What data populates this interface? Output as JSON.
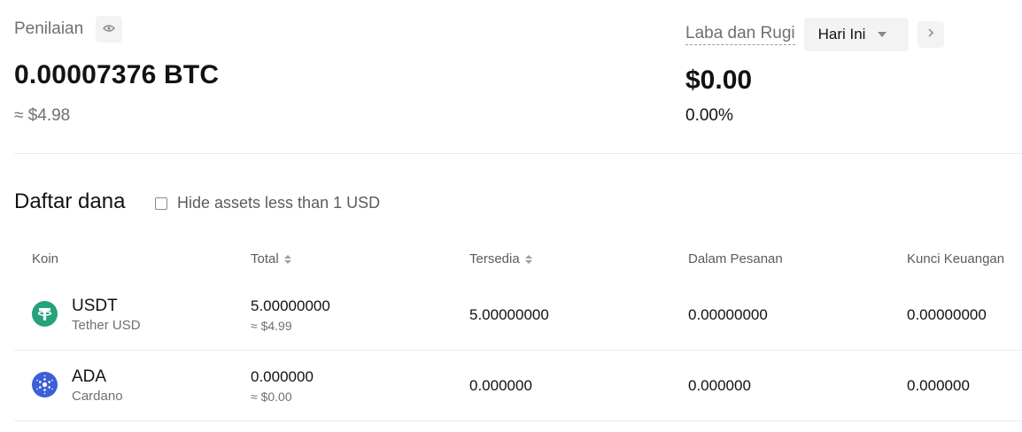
{
  "valuation": {
    "label": "Penilaian",
    "btc_amount": "0.00007376 BTC",
    "usd_approx": "≈ $4.98"
  },
  "pnl": {
    "label": "Laba dan Rugi",
    "period": "Hari Ini",
    "value": "$0.00",
    "percent": "0.00%"
  },
  "funds": {
    "title": "Daftar dana",
    "hide_small_label": "Hide assets less than 1 USD",
    "hide_small_checked": false,
    "columns": {
      "coin": "Koin",
      "total": "Total",
      "available": "Tersedia",
      "in_orders": "Dalam Pesanan",
      "financial_lock": "Kunci Keuangan"
    },
    "rows": [
      {
        "symbol": "USDT",
        "name": "Tether USD",
        "icon": "tether-icon",
        "icon_color": "#26a17b",
        "total": "5.00000000",
        "total_usd": "≈ $4.99",
        "available": "5.00000000",
        "in_orders": "0.00000000",
        "financial_lock": "0.00000000"
      },
      {
        "symbol": "ADA",
        "name": "Cardano",
        "icon": "cardano-icon",
        "icon_color": "#3d5ed6",
        "total": "0.000000",
        "total_usd": "≈ $0.00",
        "available": "0.000000",
        "in_orders": "0.000000",
        "financial_lock": "0.000000"
      }
    ]
  }
}
